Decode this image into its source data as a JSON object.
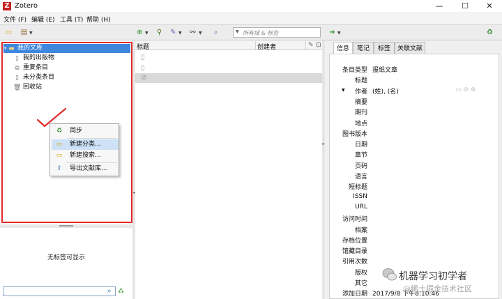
{
  "window": {
    "title": "Zotero",
    "logo_letter": "Z",
    "controls": [
      "—",
      "☐",
      "✕"
    ]
  },
  "menubar": {
    "items": [
      "文件 (F)",
      "编辑 (E)",
      "工具 (T)",
      "帮助 (H)"
    ]
  },
  "toolbar": {
    "search_placeholder": "所有域 & 标签"
  },
  "library": {
    "items": [
      {
        "label": "我的文库",
        "icon": "library-icon",
        "selected": true
      },
      {
        "label": "我的出版物",
        "icon": "publications-icon"
      },
      {
        "label": "重复条目",
        "icon": "duplicates-icon"
      },
      {
        "label": "未分类条目",
        "icon": "unfiled-icon"
      },
      {
        "label": "回收站",
        "icon": "trash-icon"
      }
    ]
  },
  "context_menu": {
    "items": [
      {
        "label": "同步",
        "icon": "sync-icon"
      },
      {
        "label": "新建分类...",
        "icon": "new-collection-icon",
        "highlighted": true
      },
      {
        "label": "新建搜索...",
        "icon": "new-search-icon"
      },
      {
        "label": "导出文献库...",
        "icon": "export-icon"
      }
    ]
  },
  "tag_selector": {
    "empty_text": "无标签可显示"
  },
  "items_list": {
    "columns": {
      "title": "标题",
      "creator": "创建者"
    }
  },
  "item_pane": {
    "tabs": [
      "信息",
      "笔记",
      "标签",
      "关联文献"
    ],
    "active_tab": "信息",
    "fields": [
      {
        "label": "条目类型",
        "value": "报纸文章"
      },
      {
        "label": "标题",
        "value": ""
      },
      {
        "label": "作者",
        "value": "(姓), (名)"
      },
      {
        "label": "摘要",
        "value": ""
      },
      {
        "label": "期刊",
        "value": ""
      },
      {
        "label": "地点",
        "value": ""
      },
      {
        "label": "图书版本",
        "value": ""
      },
      {
        "label": "日期",
        "value": ""
      },
      {
        "label": "章节",
        "value": ""
      },
      {
        "label": "页码",
        "value": ""
      },
      {
        "label": "语言",
        "value": ""
      },
      {
        "label": "短标题",
        "value": ""
      },
      {
        "label": "ISSN",
        "value": ""
      },
      {
        "label": "URL",
        "value": ""
      },
      {
        "label": "访问时间",
        "value": ""
      },
      {
        "label": "档案",
        "value": ""
      },
      {
        "label": "存档位置",
        "value": ""
      },
      {
        "label": "馆藏目录",
        "value": ""
      },
      {
        "label": "引用次数",
        "value": ""
      },
      {
        "label": "版权",
        "value": ""
      },
      {
        "label": "其它",
        "value": ""
      },
      {
        "label": "添加日期",
        "value": "2017/9/8 下午8:10:46"
      }
    ]
  },
  "watermark": {
    "text": "机器学习初学者",
    "sub": "@稀土掘金技术社区"
  },
  "colors": {
    "selection": "#3f86dd",
    "highlight_box": "#e22b2b",
    "logo": "#c5201f"
  }
}
